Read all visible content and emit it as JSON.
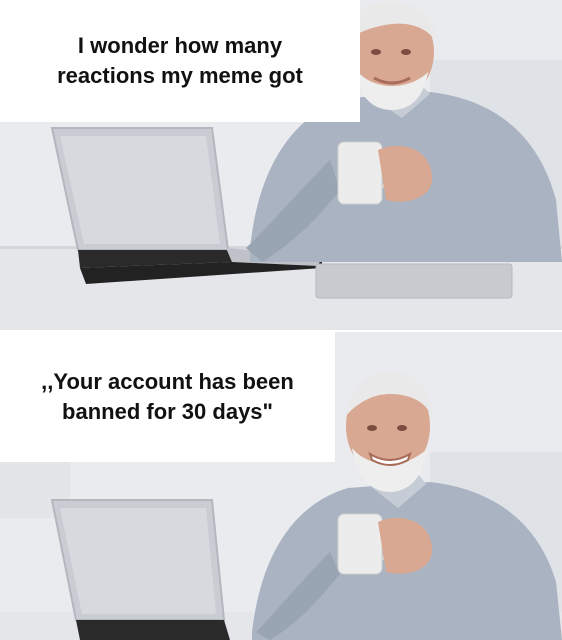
{
  "meme": {
    "panels": [
      {
        "caption": "I wonder how many\nreactions my meme got",
        "expression": "smiling"
      },
      {
        "caption": ",,Your account has been\nbanned for 30 days\"",
        "expression": "forced smile"
      }
    ]
  },
  "colors": {
    "background": "#e9ebef",
    "desk": "#e4e6ea",
    "sweater": "#a9b3c1",
    "laptop": "#c9ccd2",
    "laptop_base": "#242424",
    "skin": "#d9a892",
    "beard": "#eeeeee",
    "mug": "#ececec"
  },
  "icons": [
    "laptop-icon",
    "mug-icon",
    "old-man-icon"
  ]
}
